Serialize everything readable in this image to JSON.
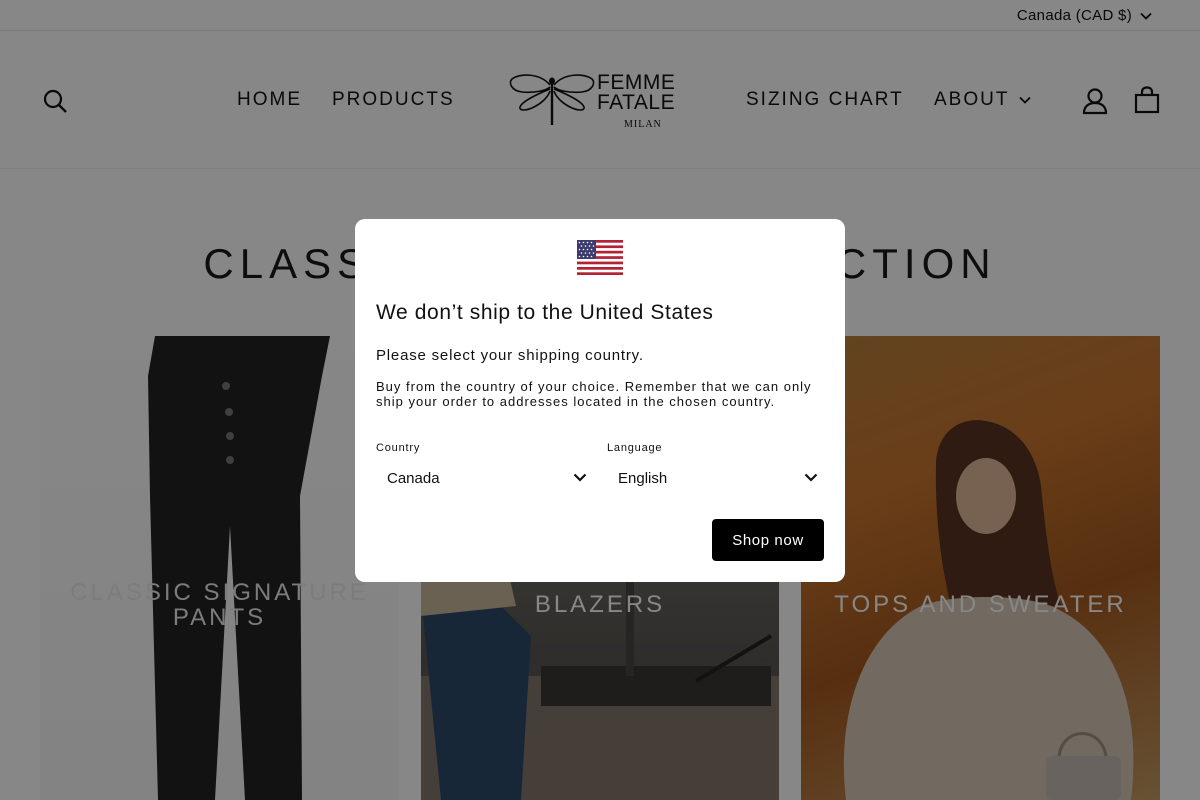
{
  "topbar": {
    "currency_label": "Canada (CAD $)"
  },
  "nav": {
    "home": "HOME",
    "products": "PRODUCTS",
    "sizing_chart": "SIZING CHART",
    "about": "ABOUT"
  },
  "logo": {
    "line1": "FEMME",
    "line2": "FATALE",
    "line3": "MILAN"
  },
  "collection": {
    "title": "CLASSIC & BASIC COLLECTION"
  },
  "cards": [
    {
      "label": "CLASSIC SIGNATURE PANTS"
    },
    {
      "label": "BLAZERS"
    },
    {
      "label": "TOPS AND SWEATER"
    }
  ],
  "modal": {
    "title": "We don’t ship to the United States",
    "subtitle": "Please select your shipping country.",
    "body": "Buy from the country of your choice. Remember that we can only ship your order to addresses located in the chosen country.",
    "country_label": "Country",
    "country_value": "Canada",
    "language_label": "Language",
    "language_value": "English",
    "shop_button": "Shop now"
  },
  "colors": {
    "overlay": "#000000",
    "button_bg": "#000000",
    "flag_red": "#b22234",
    "flag_blue": "#3c3b6e"
  }
}
